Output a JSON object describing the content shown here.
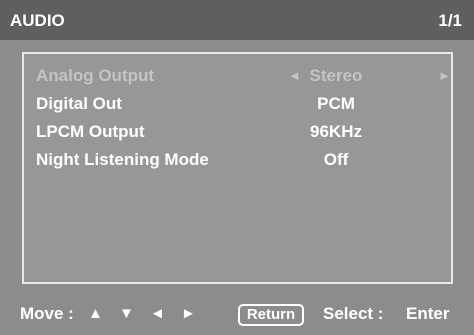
{
  "header": {
    "title": "AUDIO",
    "page": "1/1"
  },
  "menu": {
    "items": [
      {
        "label": "Analog Output",
        "value": "Stereo",
        "arrow_left": "◄",
        "arrow_right": "►",
        "state": "disabled"
      },
      {
        "label": "Digital Out",
        "value": "PCM"
      },
      {
        "label": "LPCM Output",
        "value": "96KHz"
      },
      {
        "label": "Night Listening Mode",
        "value": "Off"
      }
    ]
  },
  "footer": {
    "move_label": "Move :",
    "move_arrows": "▲ ▼ ◄ ►",
    "return_label": "Return",
    "select_label": "Select :",
    "enter_label": "Enter"
  },
  "colors": {
    "background": "#8c8c8c",
    "title_bar": "#5f5f5f",
    "panel": "#979797",
    "text": "#ffffff",
    "disabled_text": "#c4c4c4"
  }
}
